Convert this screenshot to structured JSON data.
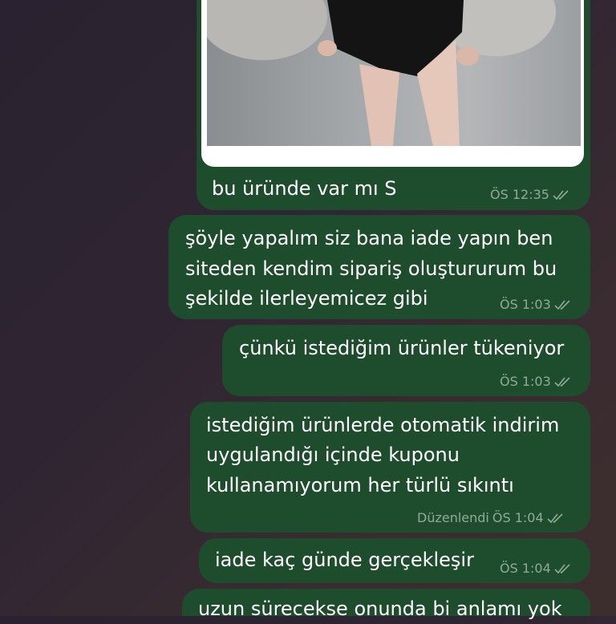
{
  "messages": [
    {
      "text_lines": [
        "bu üründe var mı S"
      ],
      "time": "ÖS 12:35",
      "edited": ""
    },
    {
      "text_lines": [
        "şöyle yapalım siz bana iade yapın ben",
        "siteden kendim sipariş oluştururum bu",
        "şekilde ilerleyemicez gibi"
      ],
      "time": "ÖS 1:03",
      "edited": ""
    },
    {
      "text_lines": [
        "çünkü istediğim ürünler tükeniyor"
      ],
      "time": "ÖS 1:03",
      "edited": ""
    },
    {
      "text_lines": [
        "istediğim ürünlerde otomatik indirim",
        "uygulandığı içinde kuponu",
        "kullanamıyorum her türlü sıkıntı"
      ],
      "time": "ÖS 1:04",
      "edited": "Düzenlendi"
    },
    {
      "text_lines": [
        "iade kaç günde gerçekleşir"
      ],
      "time": "ÖS 1:04",
      "edited": ""
    },
    {
      "text_lines": [
        "uzun sürecekse onunda bi anlamı yok"
      ],
      "time": "",
      "edited": ""
    }
  ],
  "colors": {
    "bubble": "#1e4d2e",
    "text": "#ffffff",
    "meta": "#9fb4a6"
  },
  "icons": {
    "read_status": "double-check-icon"
  }
}
